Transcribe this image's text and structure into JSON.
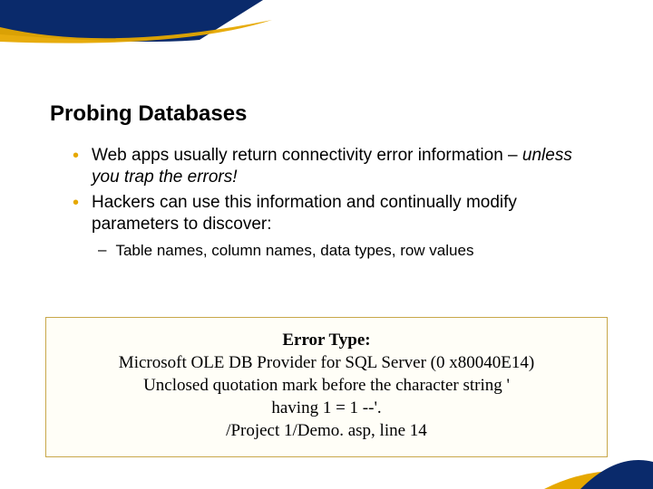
{
  "title": "Probing Databases",
  "bullets": [
    {
      "text_a": "Web apps usually return connectivity error information – ",
      "text_b_italic": "unless you trap the errors!"
    },
    {
      "text_a": "Hackers can use this information and continually modify parameters to discover:",
      "text_b_italic": ""
    }
  ],
  "sub_bullet": "Table names, column names, data types, row values",
  "error_box": {
    "line1_bold": "Error Type:",
    "line2": "Microsoft OLE DB Provider for SQL Server (0 x80040E14)",
    "line3": "Unclosed quotation mark before the character string '",
    "line4": "having 1 = 1 --'.",
    "line5": "/Project 1/Demo. asp, line 14"
  },
  "colors": {
    "navy": "#0a2a6b",
    "gold": "#e6a800"
  }
}
